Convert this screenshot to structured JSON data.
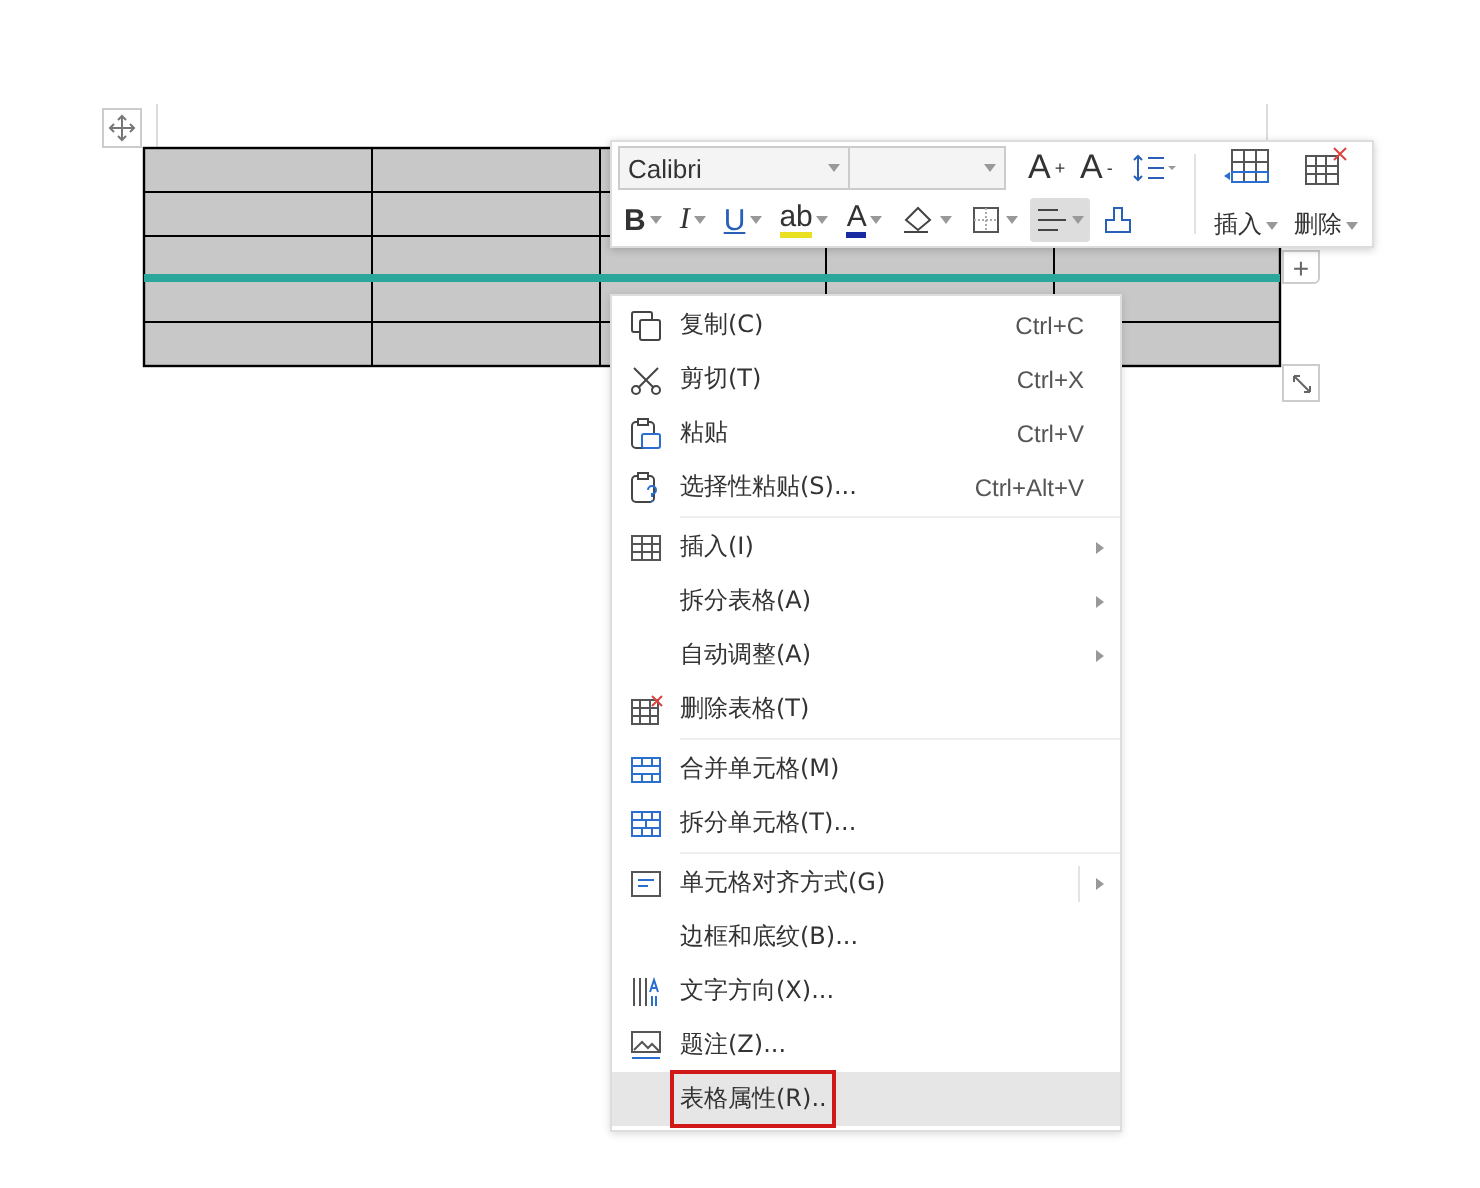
{
  "toolbar": {
    "font_name": {
      "value": "Calibri"
    },
    "font_buttons": [
      {
        "label": "A",
        "sup": "+"
      },
      {
        "label": "A",
        "sup": "-"
      }
    ],
    "format_buttons": [
      {
        "kind": "text",
        "label": "B",
        "selected": false
      },
      {
        "kind": "text",
        "label": "I",
        "selected": false
      },
      {
        "kind": "text",
        "label": "U",
        "selected": false
      },
      {
        "kind": "text",
        "label": "ab",
        "selected": false
      },
      {
        "kind": "text",
        "label": "A",
        "selected": false
      },
      {
        "kind": "icon",
        "selected": false
      },
      {
        "kind": "icon",
        "selected": false
      },
      {
        "kind": "icon",
        "selected": true
      },
      {
        "kind": "icon",
        "selected": false
      }
    ],
    "big_buttons": [
      {
        "label": "插入"
      },
      {
        "label": "删除"
      }
    ]
  },
  "menu": {
    "groups": [
      [
        {
          "label": "复制(C)",
          "shortcut": "Ctrl+C",
          "submenu": false,
          "selected": false,
          "outlined": false
        },
        {
          "label": "剪切(T)",
          "shortcut": "Ctrl+X",
          "submenu": false,
          "selected": false,
          "outlined": false
        },
        {
          "label": "粘贴",
          "shortcut": "Ctrl+V",
          "submenu": false,
          "selected": false,
          "outlined": false
        },
        {
          "label": "选择性粘贴(S)...",
          "shortcut": "Ctrl+Alt+V",
          "submenu": false,
          "selected": false,
          "outlined": false
        }
      ],
      [
        {
          "label": "插入(I)",
          "submenu": true,
          "selected": false,
          "outlined": false
        },
        {
          "label": "拆分表格(A)",
          "submenu": true,
          "selected": false,
          "outlined": false
        },
        {
          "label": "自动调整(A)",
          "submenu": true,
          "selected": false,
          "outlined": false
        },
        {
          "label": "删除表格(T)",
          "submenu": false,
          "selected": false,
          "outlined": false
        }
      ],
      [
        {
          "label": "合并单元格(M)",
          "submenu": false,
          "selected": false,
          "outlined": false
        },
        {
          "label": "拆分单元格(T)...",
          "submenu": false,
          "selected": false,
          "outlined": false
        }
      ],
      [
        {
          "label": "单元格对齐方式(G)",
          "submenu": true,
          "selected": false,
          "outlined": false
        },
        {
          "label": "边框和底纹(B)...",
          "submenu": false,
          "selected": false,
          "outlined": false
        },
        {
          "label": "文字方向(X)...",
          "submenu": false,
          "selected": false,
          "outlined": false
        },
        {
          "label": "题注(Z)...",
          "submenu": false,
          "selected": false,
          "outlined": false
        },
        {
          "label": "表格属性(R)..",
          "submenu": false,
          "selected": true,
          "outlined": true
        }
      ]
    ]
  },
  "table_controls": {
    "add_button": {
      "label": "+"
    }
  }
}
